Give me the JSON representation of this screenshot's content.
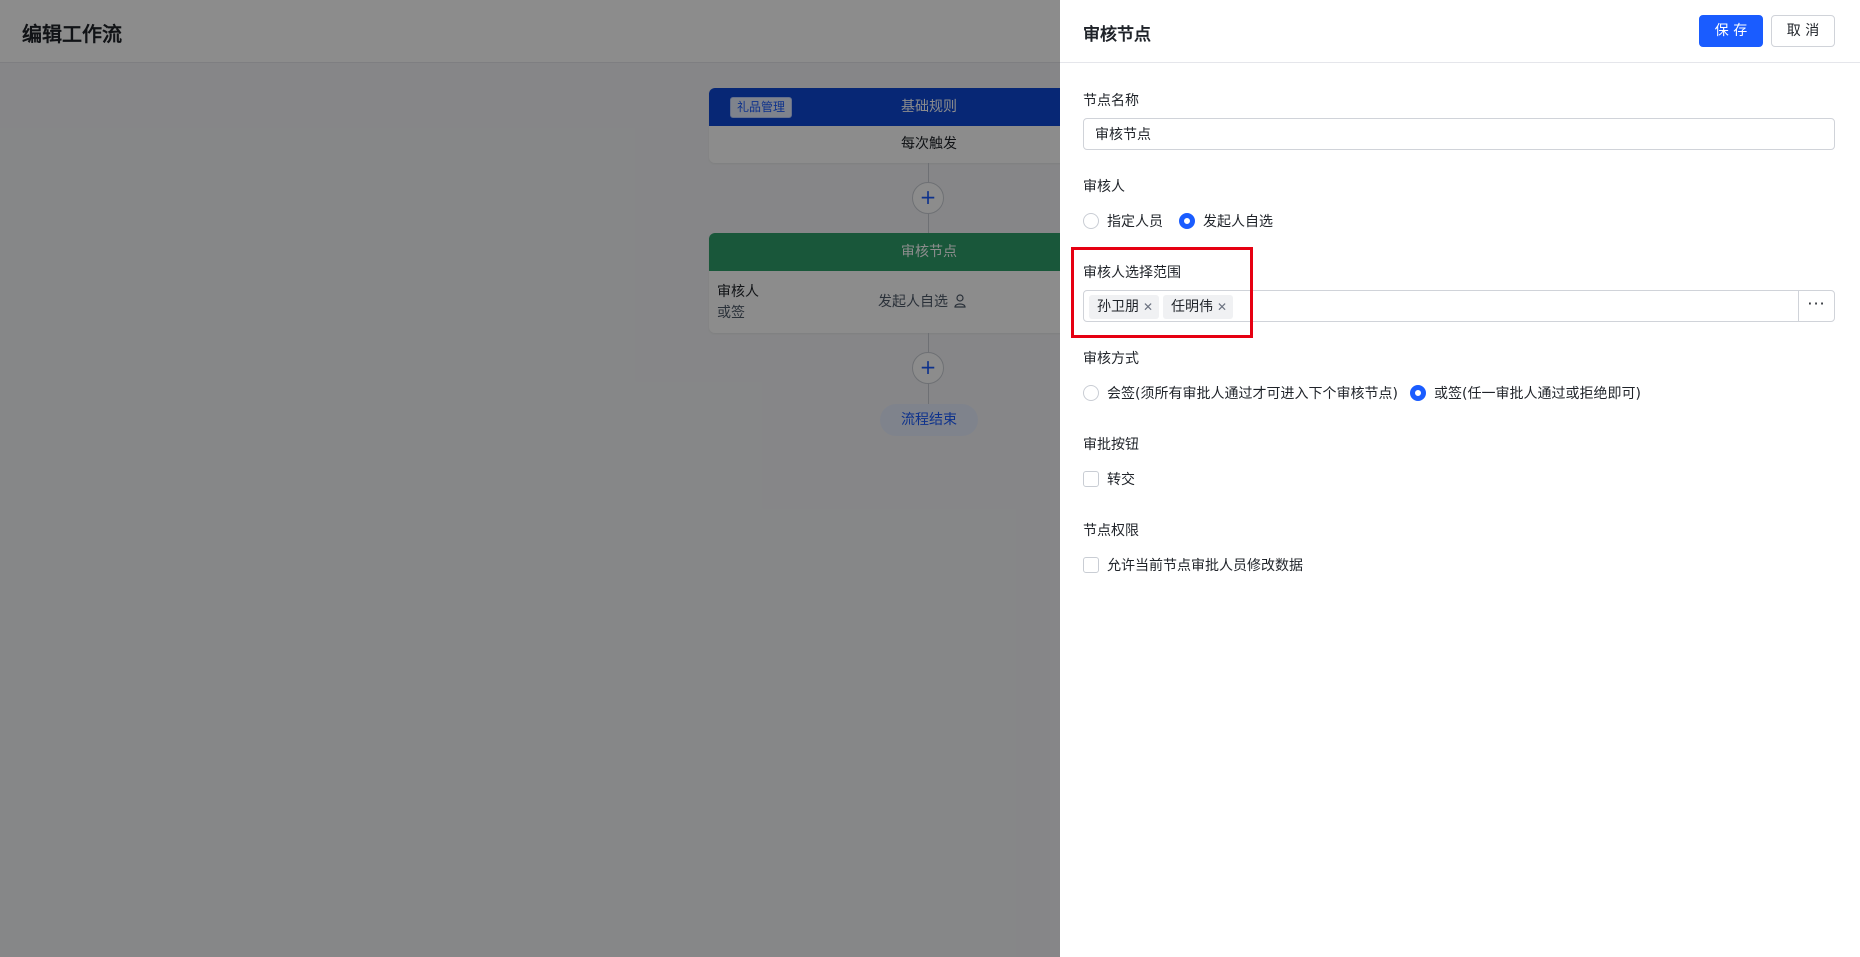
{
  "canvas": {
    "title": "编辑工作流",
    "trigger_card": {
      "tag": "礼品管理",
      "header": "基础规则",
      "body": "每次触发"
    },
    "approval_card": {
      "header": "审核节点",
      "line1": "审核人",
      "line2": "或签",
      "approver": "发起人自选"
    },
    "plus_symbol": "+",
    "end_label": "流程结束"
  },
  "drawer": {
    "title": "审核节点",
    "save_label": "保 存",
    "cancel_label": "取 消",
    "node_name_label": "节点名称",
    "node_name_value": "审核节点",
    "approver_label": "审核人",
    "approver_options": [
      "指定人员",
      "发起人自选"
    ],
    "approver_selected": "发起人自选",
    "scope_label": "审核人选择范围",
    "scope_tags": [
      "孙卫朋",
      "任明伟"
    ],
    "scope_more": "···",
    "method_label": "审核方式",
    "method_options": [
      "会签(须所有审批人通过才可进入下个审核节点)",
      "或签(任一审批人通过或拒绝即可)"
    ],
    "method_selected": "或签(任一审批人通过或拒绝即可)",
    "buttons_label": "审批按钮",
    "buttons_option": "转交",
    "permission_label": "节点权限",
    "permission_option": "允许当前节点审批人员修改数据"
  },
  "colors": {
    "primary": "#1a5cff",
    "trigger_header": "#0d47d6",
    "approval_header": "#2e9e6b",
    "highlight": "#e60012"
  }
}
